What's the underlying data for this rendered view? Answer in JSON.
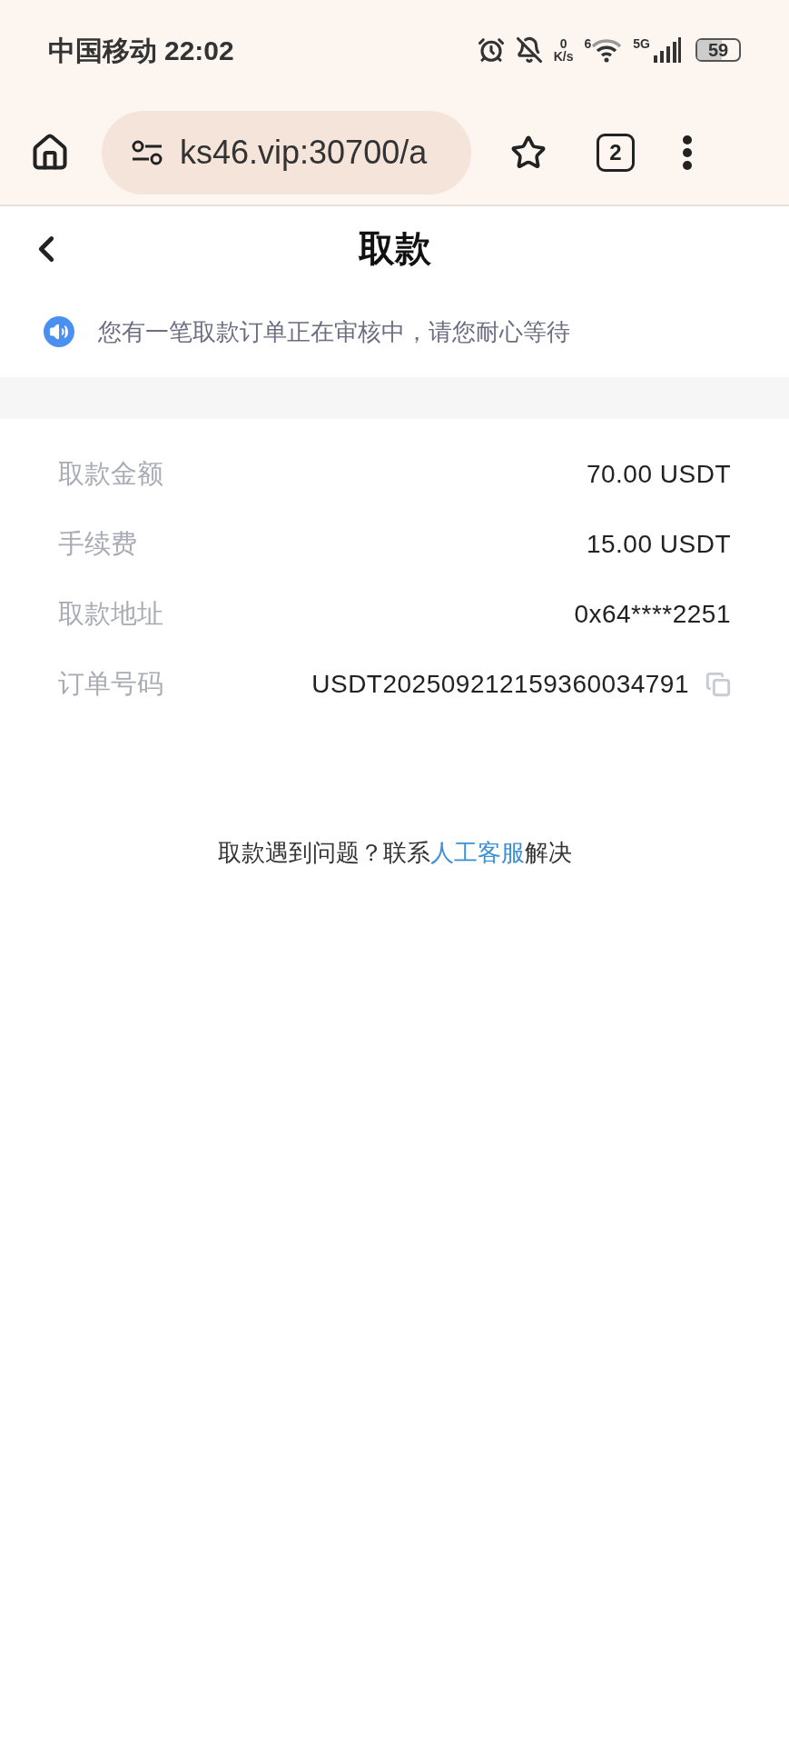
{
  "status_bar": {
    "carrier": "中国移动",
    "time": "22:02",
    "net_speed_value": "0",
    "net_speed_unit": "K/s",
    "wifi_badge": "6",
    "network": "5G",
    "battery": "59"
  },
  "browser": {
    "url": "ks46.vip:30700/a",
    "tab_count": "2"
  },
  "header": {
    "title": "取款"
  },
  "notice": {
    "text": "您有一笔取款订单正在审核中，请您耐心等待"
  },
  "details": [
    {
      "label": "取款金额",
      "value": "70.00 USDT",
      "copyable": false
    },
    {
      "label": "手续费",
      "value": "15.00 USDT",
      "copyable": false
    },
    {
      "label": "取款地址",
      "value": "0x64****2251",
      "copyable": false
    },
    {
      "label": "订单号码",
      "value": "USDT202509212159360034791",
      "copyable": true
    }
  ],
  "help": {
    "before": "取款遇到问题？联系",
    "link": "人工客服",
    "after": "解决"
  }
}
